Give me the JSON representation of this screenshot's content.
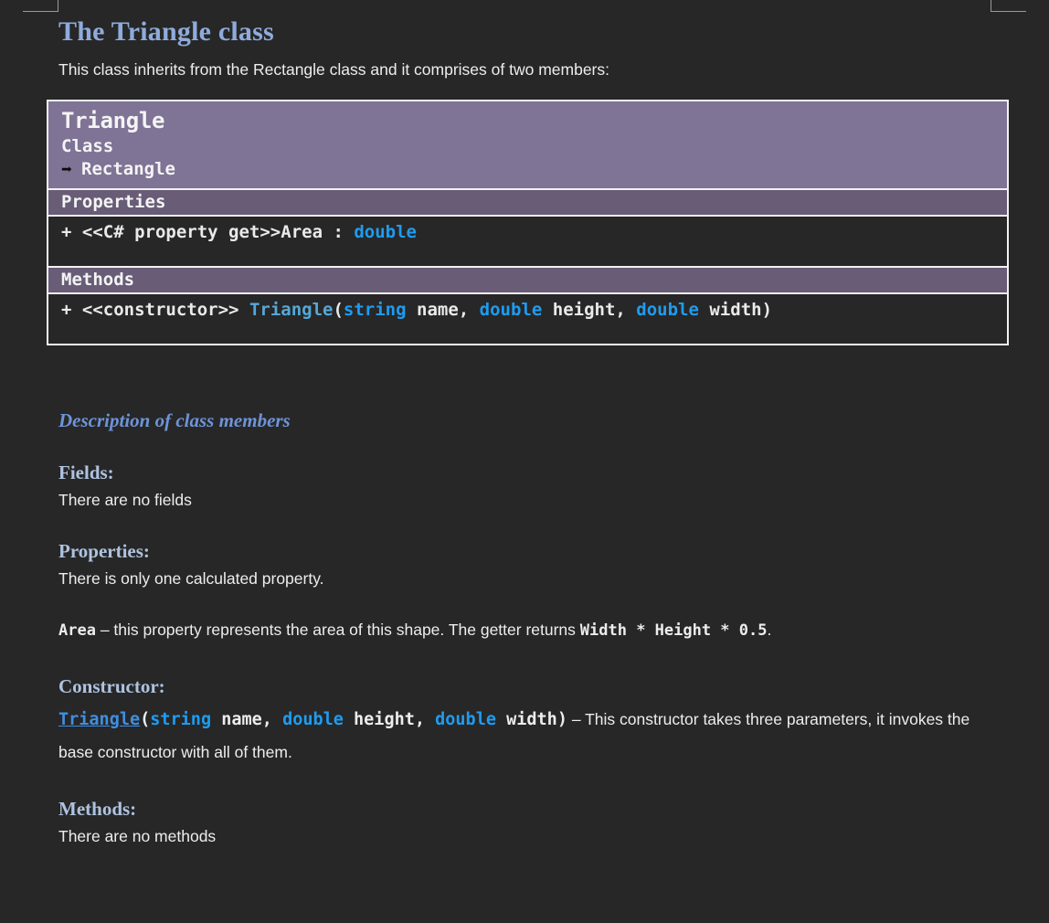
{
  "document": {
    "title": "The Triangle class",
    "intro": "This class inherits from the Rectangle class and it comprises of two members:"
  },
  "uml": {
    "class_name": "Triangle",
    "stereotype": "Class",
    "inheritance_icon": "right-arrow-icon",
    "inheritance_arrow": "➡",
    "parent_class": "Rectangle",
    "properties_band": "Properties",
    "methods_band": "Methods",
    "property_row": {
      "visibility": "+",
      "stereotype": "<<C# property get>>",
      "name": "Area",
      "separator": " : ",
      "type": "double"
    },
    "method_row": {
      "visibility": "+",
      "stereotype": "<<constructor>>",
      "name": "Triangle",
      "open_paren": "(",
      "params": [
        {
          "type": "string",
          "name": "name"
        },
        {
          "type": "double",
          "name": "height"
        },
        {
          "type": "double",
          "name": "width"
        }
      ],
      "close_paren": ")",
      "comma": ", "
    },
    "colors": {
      "header_bg": "#7f7396",
      "band_bg": "#685c77",
      "border": "#f2f2f2",
      "type_blue": "#1e9cf0",
      "name_teal": "#55a8d8"
    }
  },
  "description": {
    "heading": "Description of class members",
    "fields": {
      "label": "Fields:",
      "text": "There are no fields"
    },
    "properties": {
      "label": "Properties:",
      "text": "There is only one calculated property.",
      "member_name": "Area",
      "dash": " – this property represents the area of this shape. The getter returns ",
      "formula": "Width * Height * 0.5",
      "period": "."
    },
    "constructor": {
      "label": "Constructor:",
      "signature_name": "Triangle",
      "open_paren": "(",
      "params": [
        {
          "type": "string",
          "name": "name"
        },
        {
          "type": "double",
          "name": "height"
        },
        {
          "type": "double",
          "name": "width"
        }
      ],
      "close_paren": ")",
      "comma": ", ",
      "text": " – This constructor takes three parameters, it invokes the base constructor with all of them."
    },
    "methods": {
      "label": "Methods:",
      "text": "There are no methods"
    }
  }
}
